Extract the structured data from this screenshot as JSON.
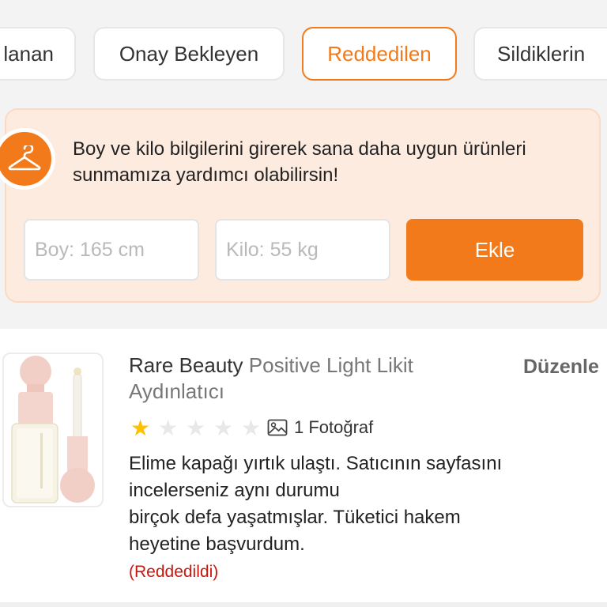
{
  "tabs": [
    {
      "label": "lanan",
      "active": false
    },
    {
      "label": "Onay Bekleyen",
      "active": false
    },
    {
      "label": "Reddedilen",
      "active": true
    },
    {
      "label": "Sildiklerin",
      "active": false
    }
  ],
  "info_box": {
    "message": "Boy ve kilo bilgilerini girerek sana daha uygun ürünleri sunmamıza yardımcı olabilirsin!",
    "height_placeholder": "Boy: 165 cm",
    "weight_placeholder": "Kilo: 55 kg",
    "add_button_label": "Ekle",
    "icon": "hanger-icon"
  },
  "review": {
    "brand": "Rare Beauty",
    "product_name": "Positive Light Likit Aydınlatıcı",
    "edit_label": "Düzenle",
    "rating": 1,
    "rating_max": 5,
    "photo_count_label": "1 Fotoğraf",
    "text_lines": [
      "Elime kapağı yırtık ulaştı. Satıcının sayfasını",
      "incelerseniz aynı durumu",
      "birçok defa yaşatmışlar. Tüketici hakem",
      "heyetine başvurdum."
    ],
    "status_label": "(Reddedildi)"
  },
  "colors": {
    "accent": "#f27a1a",
    "info_bg": "#fdebe0",
    "star_filled": "#ffc000",
    "star_empty": "#e8e8e8",
    "status_rejected": "#c8170f"
  }
}
